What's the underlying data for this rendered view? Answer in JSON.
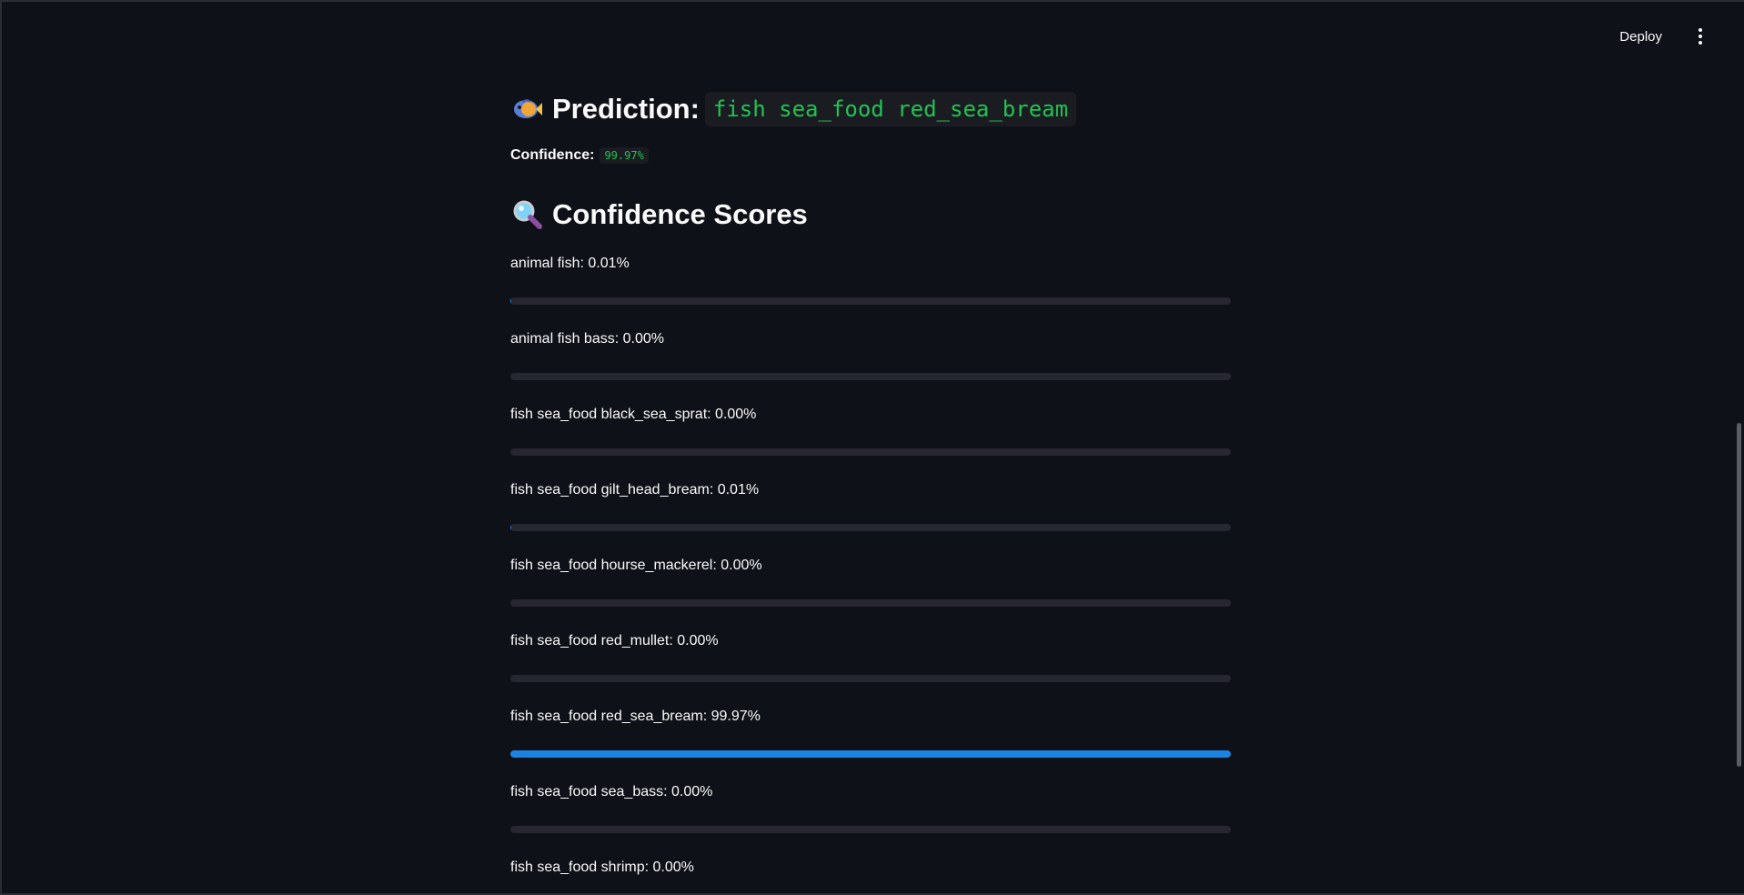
{
  "header": {
    "deploy_label": "Deploy"
  },
  "prediction": {
    "title": "Prediction:",
    "value": "fish sea_food red_sea_bream",
    "icon": "fish-icon"
  },
  "confidence": {
    "label": "Confidence:",
    "value": "99.97%"
  },
  "scores": {
    "title": "Confidence Scores",
    "icon": "magnifier-icon",
    "items": [
      {
        "label": "animal fish: 0.01%",
        "fraction": 0.0001
      },
      {
        "label": "animal fish bass: 0.00%",
        "fraction": 0.0
      },
      {
        "label": "fish sea_food black_sea_sprat: 0.00%",
        "fraction": 0.0
      },
      {
        "label": "fish sea_food gilt_head_bream: 0.01%",
        "fraction": 0.0001
      },
      {
        "label": "fish sea_food hourse_mackerel: 0.00%",
        "fraction": 0.0
      },
      {
        "label": "fish sea_food red_mullet: 0.00%",
        "fraction": 0.0
      },
      {
        "label": "fish sea_food red_sea_bream: 99.97%",
        "fraction": 0.9997
      },
      {
        "label": "fish sea_food sea_bass: 0.00%",
        "fraction": 0.0
      },
      {
        "label": "fish sea_food shrimp: 0.00%",
        "fraction": 0.0
      }
    ]
  },
  "colors": {
    "background": "#0e1117",
    "accent_green": "#21c354",
    "progress_fill": "#1c83e1",
    "progress_track": "#262730"
  }
}
